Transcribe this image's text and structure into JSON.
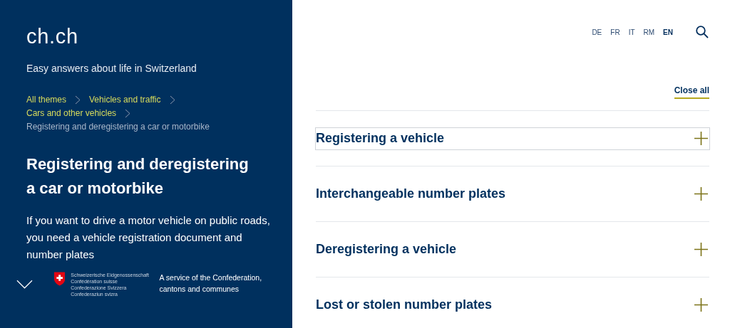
{
  "logo": "ch.ch",
  "tagline": "Easy answers about life in Switzerland",
  "breadcrumbs": [
    {
      "label": "All themes",
      "current": false
    },
    {
      "label": "Vehicles and traffic",
      "current": false
    },
    {
      "label": "Cars and other vehicles",
      "current": false
    },
    {
      "label": "Registering and deregistering a car or motorbike",
      "current": true
    }
  ],
  "title": "Registering and deregistering a car or motorbike",
  "intro": "If you want to drive a motor vehicle on public roads, you need a vehicle registration document and number plates",
  "footer": {
    "confederation": [
      "Schweizerische Eidgenossenschaft",
      "Confédération suisse",
      "Confederazione Svizzera",
      "Confederaziun svizra"
    ],
    "service": "A service of the Confederation, cantons and communes"
  },
  "languages": [
    {
      "label": "DE",
      "selected": false
    },
    {
      "label": "FR",
      "selected": false
    },
    {
      "label": "IT",
      "selected": false
    },
    {
      "label": "RM",
      "selected": false
    },
    {
      "label": "EN",
      "selected": true
    }
  ],
  "close_all": "Close all",
  "accordion": [
    {
      "title": "Registering a vehicle",
      "focused": true
    },
    {
      "title": "Interchangeable number plates",
      "focused": false
    },
    {
      "title": "Deregistering a vehicle",
      "focused": false
    },
    {
      "title": "Lost or stolen number plates",
      "focused": false
    }
  ]
}
